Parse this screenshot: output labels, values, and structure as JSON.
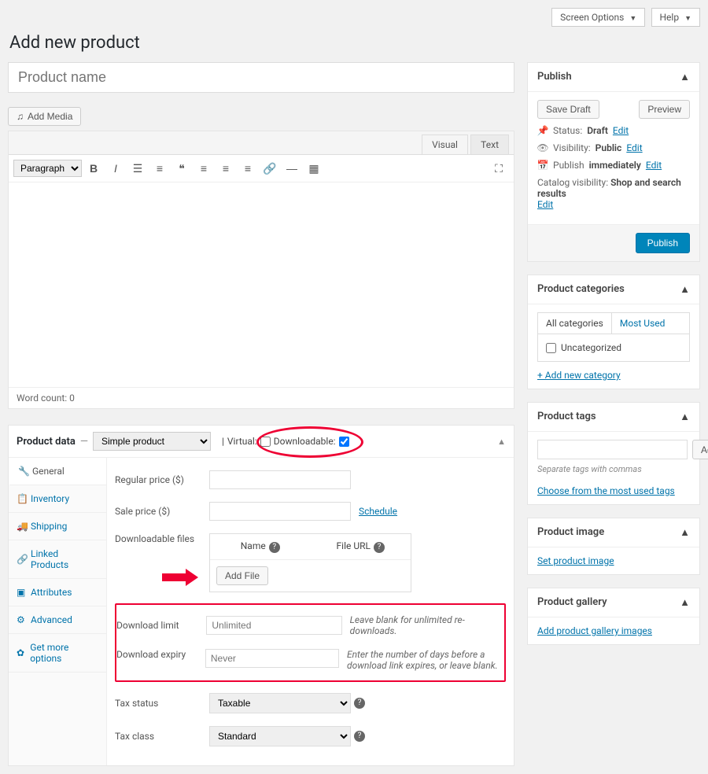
{
  "topbar": {
    "screen_options": "Screen Options",
    "help": "Help"
  },
  "page_title": "Add new product",
  "title_placeholder": "Product name",
  "add_media": "Add Media",
  "editor": {
    "visual": "Visual",
    "text": "Text",
    "paragraph_sel": "Paragraph",
    "wordcount": "Word count: 0"
  },
  "product_data": {
    "title": "Product data",
    "type_selected": "Simple product",
    "virtual_label": "Virtual:",
    "downloadable_label": "Downloadable:",
    "tabs": [
      "General",
      "Inventory",
      "Shipping",
      "Linked Products",
      "Attributes",
      "Advanced",
      "Get more options"
    ],
    "regular_price": "Regular price ($)",
    "sale_price": "Sale price ($)",
    "schedule": "Schedule",
    "dl_files_label": "Downloadable files",
    "dl_name": "Name",
    "dl_url": "File URL",
    "add_file": "Add File",
    "dl_limit_label": "Download limit",
    "dl_limit_placeholder": "Unlimited",
    "dl_limit_hint": "Leave blank for unlimited re-downloads.",
    "dl_expiry_label": "Download expiry",
    "dl_expiry_placeholder": "Never",
    "dl_expiry_hint": "Enter the number of days before a download link expires, or leave blank.",
    "tax_status_label": "Tax status",
    "tax_status": "Taxable",
    "tax_class_label": "Tax class",
    "tax_class": "Standard"
  },
  "publish": {
    "title": "Publish",
    "save_draft": "Save Draft",
    "preview": "Preview",
    "status_lbl": "Status:",
    "status": "Draft",
    "visibility_lbl": "Visibility:",
    "visibility": "Public",
    "publish_lbl": "Publish",
    "publish_when": "immediately",
    "catalog_lbl": "Catalog visibility:",
    "catalog": "Shop and search results",
    "edit": "Edit",
    "publish_btn": "Publish"
  },
  "categories": {
    "title": "Product categories",
    "all": "All categories",
    "most_used": "Most Used",
    "uncat": "Uncategorized",
    "add_new": "+ Add new category"
  },
  "tags": {
    "title": "Product tags",
    "add": "Add",
    "hint": "Separate tags with commas",
    "choose": "Choose from the most used tags"
  },
  "image": {
    "title": "Product image",
    "set": "Set product image"
  },
  "gallery": {
    "title": "Product gallery",
    "add": "Add product gallery images"
  }
}
